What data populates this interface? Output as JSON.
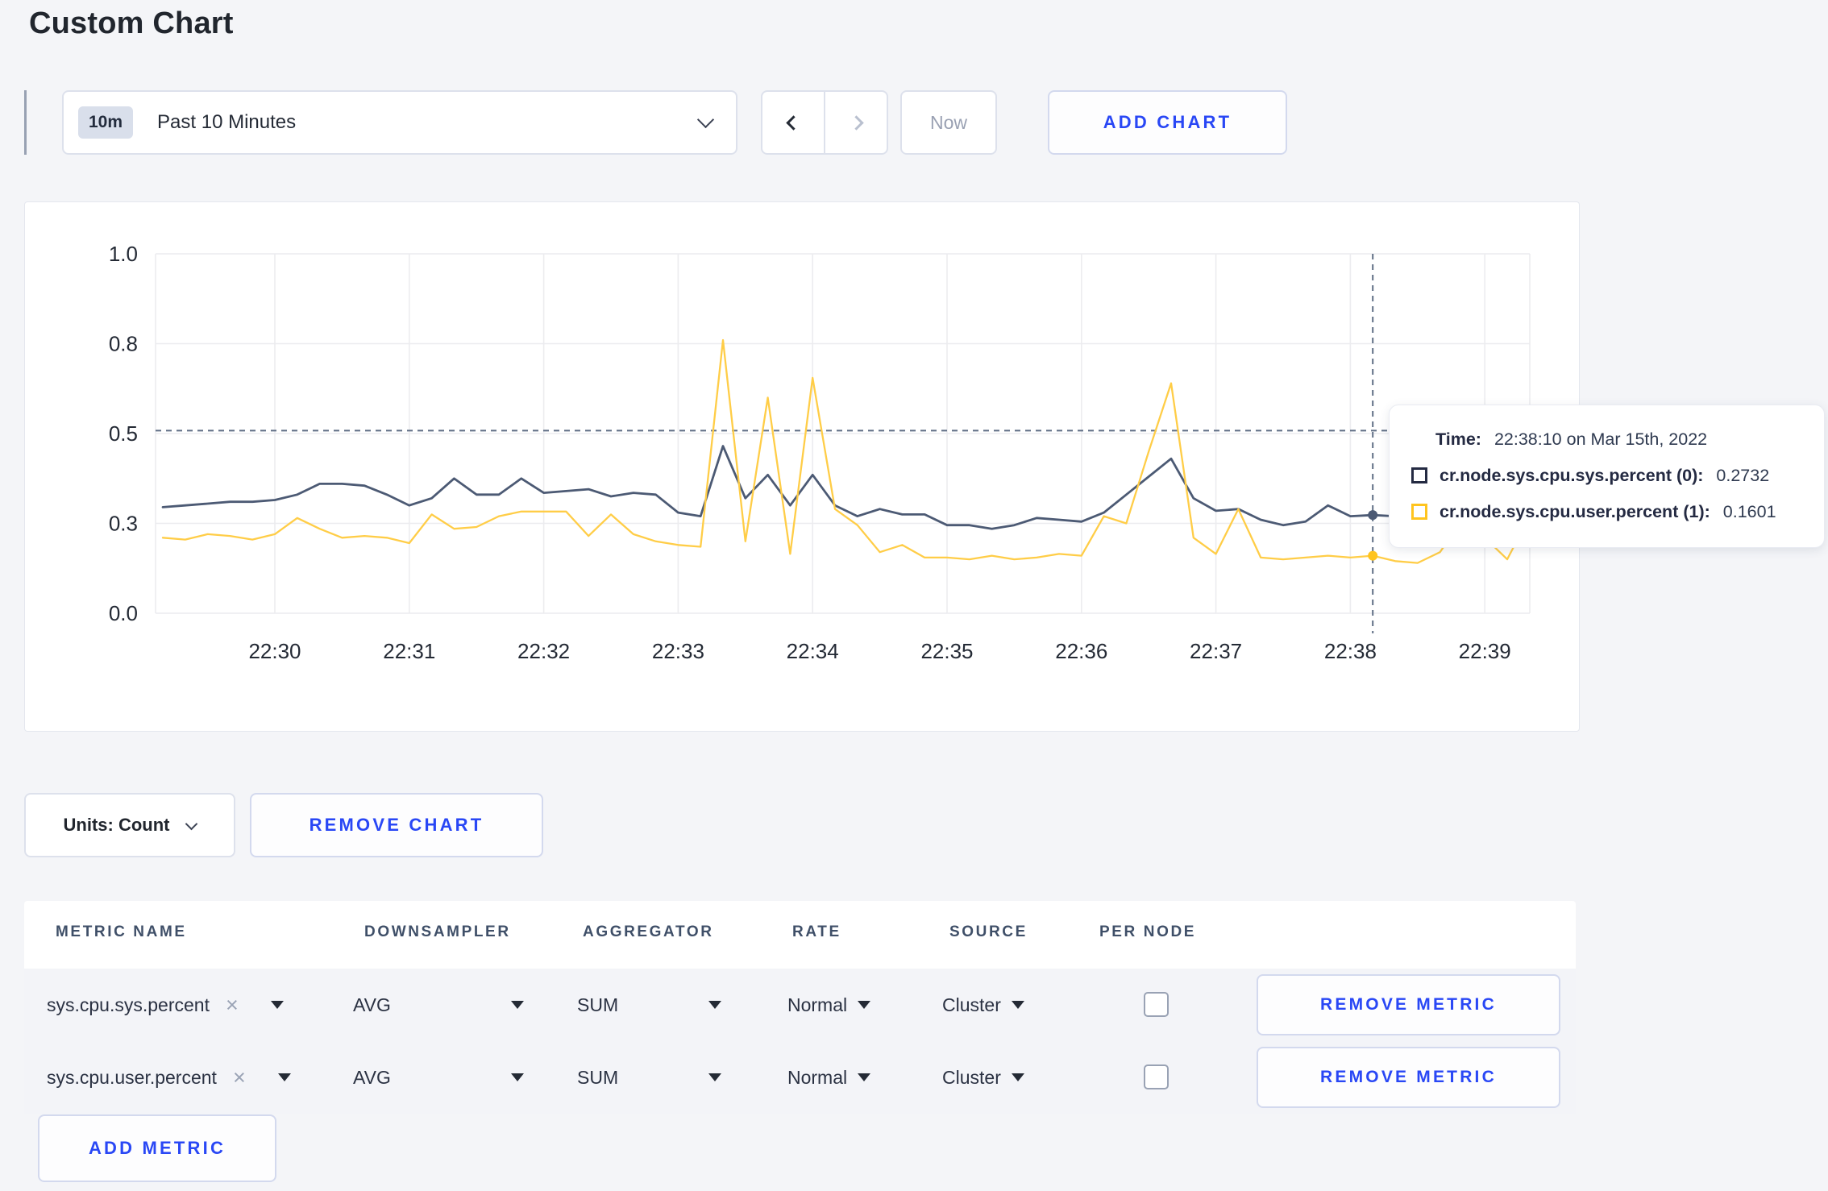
{
  "page": {
    "title": "Custom Chart",
    "accent_blue": "#2947f5",
    "background": "#f4f5f8"
  },
  "toolbar": {
    "time_range": {
      "badge": "10m",
      "label": "Past 10 Minutes"
    },
    "now_label": "Now",
    "add_chart_label": "ADD CHART"
  },
  "units_bar": {
    "units_label": "Units: Count",
    "remove_chart_label": "REMOVE CHART"
  },
  "metrics_table": {
    "headers": [
      "METRIC NAME",
      "DOWNSAMPLER",
      "AGGREGATOR",
      "RATE",
      "SOURCE",
      "PER NODE"
    ],
    "rows": [
      {
        "metric": "sys.cpu.sys.percent",
        "downsampler": "AVG",
        "aggregator": "SUM",
        "rate": "Normal",
        "source": "Cluster",
        "per_node_checked": false,
        "remove_label": "REMOVE METRIC"
      },
      {
        "metric": "sys.cpu.user.percent",
        "downsampler": "AVG",
        "aggregator": "SUM",
        "rate": "Normal",
        "source": "Cluster",
        "per_node_checked": false,
        "remove_label": "REMOVE METRIC"
      }
    ],
    "add_metric_label": "ADD METRIC"
  },
  "chart_data": {
    "type": "line",
    "title": "",
    "xlabel": "",
    "ylabel": "",
    "ylim": [
      0,
      1
    ],
    "grid": true,
    "x_ticks": [
      "22:30",
      "22:31",
      "22:32",
      "22:33",
      "22:34",
      "22:35",
      "22:36",
      "22:37",
      "22:38",
      "22:39"
    ],
    "y_ticks": [
      {
        "value": 0,
        "label": "0.0"
      },
      {
        "value": 0.25,
        "label": "0.3"
      },
      {
        "value": 0.5,
        "label": "0.5"
      },
      {
        "value": 0.75,
        "label": "0.8"
      },
      {
        "value": 1.0,
        "label": "1.0"
      }
    ],
    "x_times": [
      "22:29:10",
      "22:29:20",
      "22:29:30",
      "22:29:40",
      "22:29:50",
      "22:30:00",
      "22:30:10",
      "22:30:20",
      "22:30:30",
      "22:30:40",
      "22:30:50",
      "22:31:00",
      "22:31:10",
      "22:31:20",
      "22:31:30",
      "22:31:40",
      "22:31:50",
      "22:32:00",
      "22:32:10",
      "22:32:20",
      "22:32:30",
      "22:32:40",
      "22:32:50",
      "22:33:00",
      "22:33:10",
      "22:33:20",
      "22:33:30",
      "22:33:40",
      "22:33:50",
      "22:34:00",
      "22:34:10",
      "22:34:20",
      "22:34:30",
      "22:34:40",
      "22:34:50",
      "22:35:00",
      "22:35:10",
      "22:35:20",
      "22:35:30",
      "22:35:40",
      "22:35:50",
      "22:36:00",
      "22:36:10",
      "22:36:20",
      "22:36:30",
      "22:36:40",
      "22:36:50",
      "22:37:00",
      "22:37:10",
      "22:37:20",
      "22:37:30",
      "22:37:40",
      "22:37:50",
      "22:38:00",
      "22:38:10",
      "22:38:20",
      "22:38:30",
      "22:38:40",
      "22:38:50",
      "22:39:00",
      "22:39:10",
      "22:39:20"
    ],
    "series": [
      {
        "name": "cr.node.sys.cpu.sys.percent (0)",
        "color": "#4c5a74",
        "values": [
          0.295,
          0.3,
          0.305,
          0.31,
          0.31,
          0.315,
          0.33,
          0.36,
          0.36,
          0.355,
          0.33,
          0.3,
          0.32,
          0.375,
          0.33,
          0.33,
          0.375,
          0.335,
          0.34,
          0.345,
          0.325,
          0.335,
          0.33,
          0.28,
          0.27,
          0.465,
          0.32,
          0.385,
          0.3,
          0.385,
          0.3,
          0.27,
          0.29,
          0.275,
          0.275,
          0.245,
          0.245,
          0.235,
          0.245,
          0.265,
          0.26,
          0.255,
          0.28,
          0.33,
          0.38,
          0.43,
          0.32,
          0.285,
          0.29,
          0.26,
          0.245,
          0.255,
          0.3,
          0.27,
          0.2732,
          0.27,
          0.25,
          0.26,
          0.27,
          0.26,
          0.25,
          0.27
        ]
      },
      {
        "name": "cr.node.sys.cpu.user.percent (1)",
        "color": "#ffcd47",
        "values": [
          0.21,
          0.205,
          0.22,
          0.215,
          0.205,
          0.22,
          0.265,
          0.235,
          0.21,
          0.215,
          0.21,
          0.195,
          0.275,
          0.235,
          0.24,
          0.27,
          0.283,
          0.283,
          0.283,
          0.215,
          0.275,
          0.22,
          0.2,
          0.19,
          0.185,
          0.76,
          0.2,
          0.6,
          0.165,
          0.655,
          0.29,
          0.245,
          0.17,
          0.19,
          0.155,
          0.155,
          0.15,
          0.16,
          0.15,
          0.155,
          0.165,
          0.16,
          0.27,
          0.25,
          0.45,
          0.64,
          0.21,
          0.165,
          0.29,
          0.155,
          0.15,
          0.155,
          0.16,
          0.155,
          0.1601,
          0.145,
          0.14,
          0.17,
          0.26,
          0.21,
          0.15,
          0.27
        ]
      }
    ],
    "crosshair": {
      "hover_time": "22:38:10",
      "horizontal_value": 0.508
    },
    "tooltip": {
      "time_label": "Time:",
      "time": "22:38:10 on Mar 15th, 2022",
      "rows": [
        {
          "label": "cr.node.sys.cpu.sys.percent (0):",
          "value": "0.2732",
          "color": "#242a42"
        },
        {
          "label": "cr.node.sys.cpu.user.percent (1):",
          "value": "0.1601",
          "color": "#ffc41e"
        }
      ]
    }
  }
}
